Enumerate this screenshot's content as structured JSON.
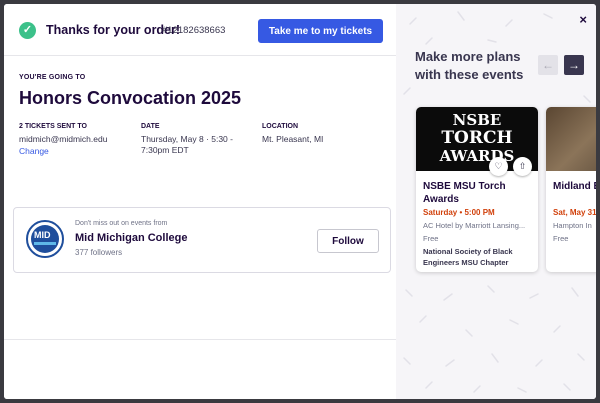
{
  "header": {
    "thanks": "Thanks for your order!",
    "order_number": "#12182638663",
    "tickets_button": "Take me to my tickets"
  },
  "event": {
    "going_label": "YOU'RE GOING TO",
    "title": "Honors Convocation 2025"
  },
  "details": {
    "sent_label": "2 TICKETS SENT TO",
    "email": "midmich@midmich.edu",
    "change_link": "Change",
    "date_label": "DATE",
    "date_value": "Thursday, May 8 · 5:30 - 7:30pm EDT",
    "location_label": "LOCATION",
    "location_value": "Mt. Pleasant, MI"
  },
  "organizer": {
    "dont_miss": "Don't miss out on events from",
    "name": "Mid Michigan College",
    "followers": "377 followers",
    "follow_button": "Follow",
    "logo_text": "MID"
  },
  "more": {
    "title": "Make more plans with these events",
    "close": "×",
    "prev": "←",
    "next": "→",
    "cards": [
      {
        "image_lines": [
          "NSBE",
          "TORCH",
          "AWARDS"
        ],
        "title": "NSBE MSU Torch Awards",
        "date": "Saturday • 5:00 PM",
        "venue": "AC Hotel by Marriott Lansing...",
        "price": "Free",
        "organizer": "National Society of Black Engineers MSU Chapter"
      },
      {
        "title": "Midland Epoxy F",
        "date": "Sat, May 31",
        "venue": "Hampton In",
        "price": "Free"
      }
    ]
  },
  "colors": {
    "primary": "#3659e3",
    "success": "#3cc18a",
    "date_accent": "#d1410c",
    "text_dark": "#1e0a3c"
  }
}
